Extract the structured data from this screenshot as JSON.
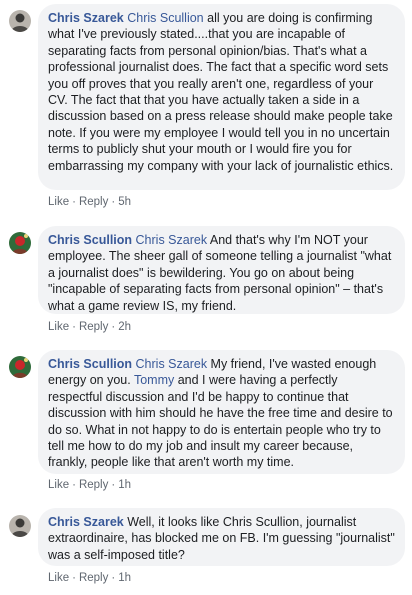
{
  "colors": {
    "bubble": "#f2f3f5",
    "link": "#385898",
    "meta": "#606770"
  },
  "comments": [
    {
      "author": "Chris Szarek",
      "mention": "Chris Scullion",
      "text": " all you are doing is confirming what I've previously stated....that you are incapable of separating facts from personal opinion/bias. That's what a professional journalist does. The fact that a specific word sets you off proves that you really aren't one, regardless of your CV. The fact that that you have actually taken a side in a discussion based on a press release should make people take note. If you were my employee I would tell you in no uncertain terms to publicly shut your mouth or I would fire you for embarrassing my company with your lack of journalistic ethics.",
      "like": "Like",
      "reply": "Reply",
      "time": "5h",
      "avatar_icon": "profile-photo-chris-szarek"
    },
    {
      "author": "Chris Scullion",
      "mention": "Chris Szarek",
      "text": " And that's why I'm NOT your employee. The sheer gall of someone telling a journalist \"what a journalist does\" is bewildering. You go on about being \"incapable of separating facts from personal opinion\" – that's what a game review IS, my friend.",
      "like": "Like",
      "reply": "Reply",
      "time": "2h",
      "avatar_icon": "profile-photo-chris-scullion"
    },
    {
      "author": "Chris Scullion",
      "mention": "Chris Szarek",
      "text_a": " My friend, I've wasted enough energy on you. ",
      "mention2": "Tommy",
      "text_b": " and I were having a perfectly respectful discussion and I'd be happy to continue that discussion with him should he have the free time and desire to do so. What in not happy to do is entertain people who try to tell me how to do my job and insult my career because, frankly, people like that aren't worth my time.",
      "like": "Like",
      "reply": "Reply",
      "time": "1h",
      "avatar_icon": "profile-photo-chris-scullion"
    },
    {
      "author": "Chris Szarek",
      "text": " Well, it looks like Chris Scullion, journalist extraordinaire, has blocked me on FB. I'm guessing \"journalist\" was a self-imposed title?",
      "like": "Like",
      "reply": "Reply",
      "time": "1h",
      "avatar_icon": "profile-photo-chris-szarek"
    }
  ]
}
